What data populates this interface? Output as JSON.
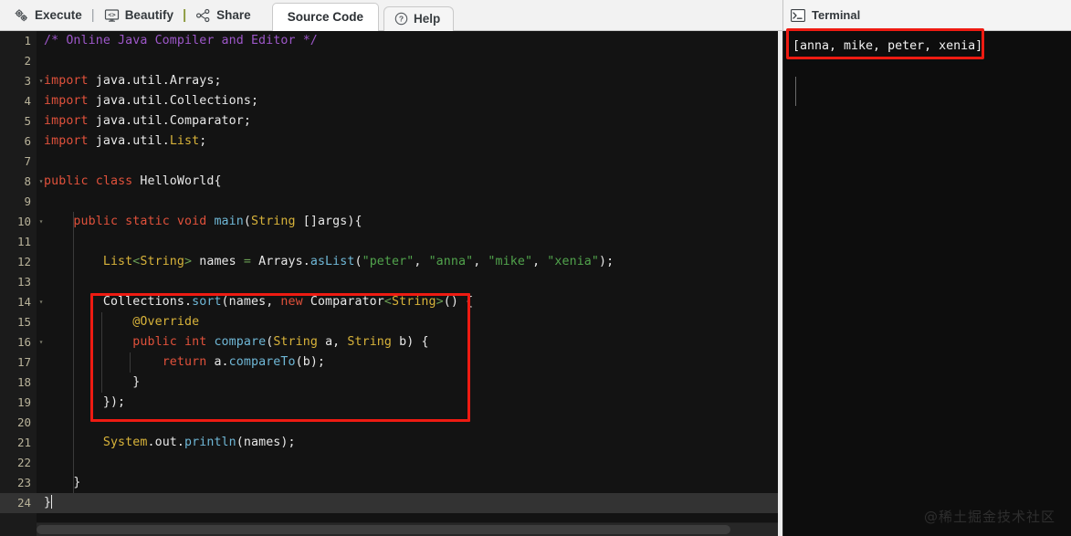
{
  "toolbar": {
    "execute_label": "Execute",
    "execute_icon": "gears-icon",
    "beautify_label": "Beautify",
    "beautify_icon": "monitor-code-icon",
    "share_label": "Share",
    "share_icon": "share-nodes-icon",
    "separator": "|",
    "tabs": [
      {
        "label": "Source Code",
        "active": true
      }
    ],
    "help_label": "Help",
    "help_icon": "question-circle-icon"
  },
  "terminal": {
    "title": "Terminal",
    "icon": "terminal-prompt-icon",
    "output": "[anna, mike, peter, xenia]"
  },
  "editor": {
    "active_line": 24,
    "lines": [
      {
        "n": 1,
        "fold": false,
        "guides": 0
      },
      {
        "n": 2,
        "fold": false,
        "guides": 0
      },
      {
        "n": 3,
        "fold": true,
        "guides": 0
      },
      {
        "n": 4,
        "fold": false,
        "guides": 0
      },
      {
        "n": 5,
        "fold": false,
        "guides": 0
      },
      {
        "n": 6,
        "fold": false,
        "guides": 0
      },
      {
        "n": 7,
        "fold": false,
        "guides": 0
      },
      {
        "n": 8,
        "fold": true,
        "guides": 0
      },
      {
        "n": 9,
        "fold": false,
        "guides": 0
      },
      {
        "n": 10,
        "fold": true,
        "guides": 1
      },
      {
        "n": 11,
        "fold": false,
        "guides": 1
      },
      {
        "n": 12,
        "fold": false,
        "guides": 1
      },
      {
        "n": 13,
        "fold": false,
        "guides": 1
      },
      {
        "n": 14,
        "fold": true,
        "guides": 1
      },
      {
        "n": 15,
        "fold": false,
        "guides": 2
      },
      {
        "n": 16,
        "fold": true,
        "guides": 2
      },
      {
        "n": 17,
        "fold": false,
        "guides": 3
      },
      {
        "n": 18,
        "fold": false,
        "guides": 2
      },
      {
        "n": 19,
        "fold": false,
        "guides": 1
      },
      {
        "n": 20,
        "fold": false,
        "guides": 1
      },
      {
        "n": 21,
        "fold": false,
        "guides": 1
      },
      {
        "n": 22,
        "fold": false,
        "guides": 1
      },
      {
        "n": 23,
        "fold": false,
        "guides": 1
      },
      {
        "n": 24,
        "fold": false,
        "guides": 0
      }
    ],
    "code": [
      "/* Online Java Compiler and Editor */",
      "",
      "import java.util.Arrays;",
      "import java.util.Collections;",
      "import java.util.Comparator;",
      "import java.util.List;",
      "",
      "public class HelloWorld{",
      "",
      "    public static void main(String []args){",
      "",
      "        List<String> names = Arrays.asList(\"peter\", \"anna\", \"mike\", \"xenia\");",
      "",
      "        Collections.sort(names, new Comparator<String>() {",
      "            @Override",
      "            public int compare(String a, String b) {",
      "                return a.compareTo(b);",
      "            }",
      "        });",
      "",
      "        System.out.println(names);",
      "",
      "    }",
      "}"
    ]
  },
  "watermark": {
    "text": "@稀土掘金技术社区"
  },
  "colors": {
    "accent_highlight": "#ee1b12",
    "editor_bg": "#131313",
    "gutter_bg": "#1b1b1b",
    "terminal_bg": "#0d0d0d",
    "keyword": "#e0513b",
    "type": "#d8b33a",
    "string": "#51a34c",
    "comment": "#9d57c9",
    "function": "#6fb7d6",
    "toolbar_bg": "#f2f2f2"
  }
}
